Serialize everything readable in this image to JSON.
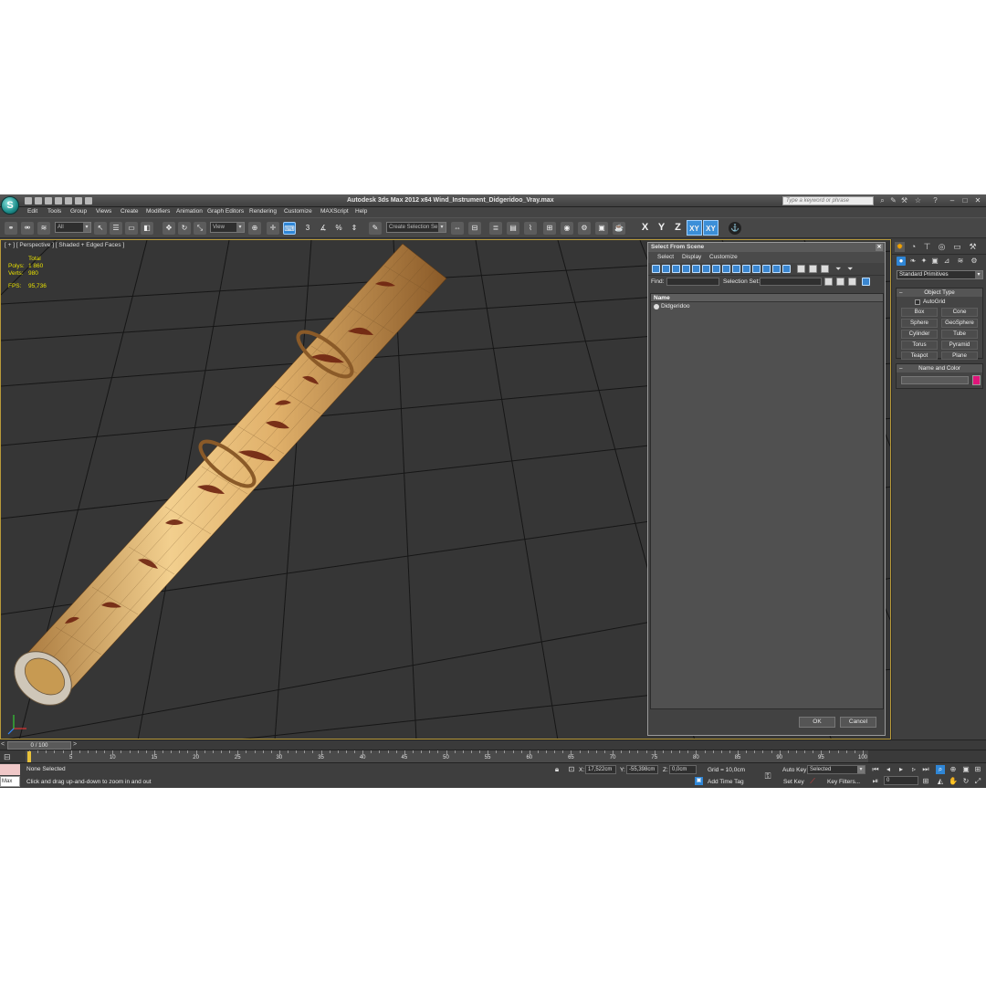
{
  "window": {
    "title": "Autodesk 3ds Max  2012 x64     Wind_Instrument_Didgeridoo_Vray.max",
    "search_placeholder": "Type a keyword or phrase"
  },
  "menu": [
    "Edit",
    "Tools",
    "Group",
    "Views",
    "Create",
    "Modifiers",
    "Animation",
    "Graph Editors",
    "Rendering",
    "Customize",
    "MAXScript",
    "Help"
  ],
  "toolbar": {
    "filter_value": "All",
    "refcoord_value": "View",
    "selection_set_value": "Create Selection Se",
    "snap_label": "3",
    "axis_x": "X",
    "axis_y": "Y",
    "axis_z": "Z",
    "axis_xy": "XY",
    "axis_xy2": "XY"
  },
  "viewport": {
    "label": "[ + ] [ Perspective ] [ Shaded + Edged Faces ]",
    "stats": {
      "total_label": "Total",
      "polys_label": "Polys:",
      "polys_value": "1 860",
      "verts_label": "Verts:",
      "verts_value": "980",
      "fps_label": "FPS:",
      "fps_value": "95,736"
    }
  },
  "dialog": {
    "title": "Select From Scene",
    "menu": [
      "Select",
      "Display",
      "Customize"
    ],
    "find_label": "Find:",
    "selection_set_label": "Selection Set:",
    "column_name": "Name",
    "items": [
      "Didgeridoo"
    ],
    "ok_label": "OK",
    "cancel_label": "Cancel"
  },
  "command_panel": {
    "category": "Standard Primitives",
    "object_type_title": "Object Type",
    "autogrid_label": "AutoGrid",
    "primitives": [
      "Box",
      "Cone",
      "Sphere",
      "GeoSphere",
      "Cylinder",
      "Tube",
      "Torus",
      "Pyramid",
      "Teapot",
      "Plane"
    ],
    "name_color_title": "Name and Color",
    "object_color": "#e0157a"
  },
  "timeline": {
    "slider_label": "0 / 100",
    "ticks": [
      0,
      5,
      10,
      15,
      20,
      25,
      30,
      35,
      40,
      45,
      50,
      55,
      60,
      65,
      70,
      75,
      80,
      85,
      90,
      95,
      100
    ]
  },
  "status": {
    "maxscript_label": "Max",
    "selection": "None Selected",
    "prompt": "Click and drag up-and-down to zoom in and out",
    "x_label": "X:",
    "x_value": "17,522cm",
    "y_label": "Y:",
    "y_value": "-55,398cm",
    "z_label": "Z:",
    "z_value": "0,0cm",
    "grid": "Grid = 10,0cm",
    "add_time_tag": "Add Time Tag",
    "auto_key": "Auto Key",
    "set_key": "Set Key",
    "key_mode_value": "Selected",
    "key_filters": "Key Filters...",
    "frame_value": "0"
  },
  "colors": {
    "accent": "#2f86d6",
    "viewport_bg": "#363636",
    "bamboo": "#e3b872",
    "burn": "#7a2a12"
  }
}
